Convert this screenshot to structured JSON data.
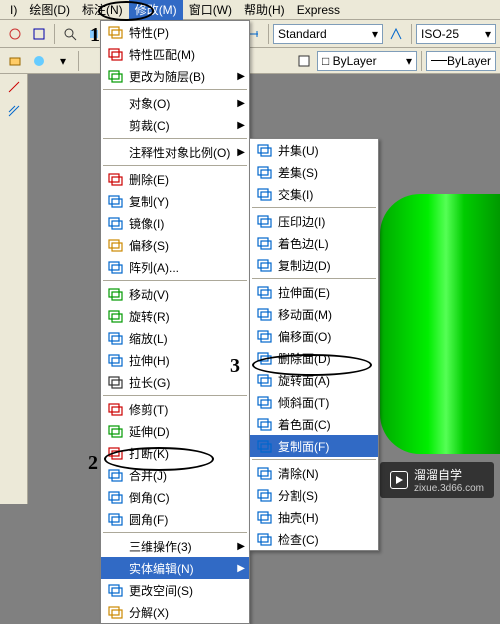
{
  "menubar": {
    "items": [
      "I)",
      "绘图(D)",
      "标注(N)",
      "修改(M)",
      "窗口(W)",
      "帮助(H)",
      "Express"
    ],
    "active": 3
  },
  "toolbar_dd": {
    "std": "Standard",
    "iso": "ISO-25",
    "layer": "ByLayer",
    "color": "□ ByLayer"
  },
  "menu1": [
    {
      "lbl": "特性(P)",
      "ico": "props"
    },
    {
      "lbl": "特性匹配(M)",
      "ico": "match"
    },
    {
      "lbl": "更改为随层(B)",
      "ico": "bylayer",
      "ar": true
    },
    {
      "sep": true
    },
    {
      "lbl": "对象(O)",
      "ar": true
    },
    {
      "lbl": "剪裁(C)",
      "ar": true
    },
    {
      "sep": true
    },
    {
      "lbl": "注释性对象比例(O)",
      "ar": true
    },
    {
      "sep": true
    },
    {
      "lbl": "删除(E)",
      "ico": "erase"
    },
    {
      "lbl": "复制(Y)",
      "ico": "copy"
    },
    {
      "lbl": "镜像(I)",
      "ico": "mirror"
    },
    {
      "lbl": "偏移(S)",
      "ico": "offset"
    },
    {
      "lbl": "阵列(A)...",
      "ico": "array"
    },
    {
      "sep": true
    },
    {
      "lbl": "移动(V)",
      "ico": "move"
    },
    {
      "lbl": "旋转(R)",
      "ico": "rotate"
    },
    {
      "lbl": "缩放(L)",
      "ico": "scale"
    },
    {
      "lbl": "拉伸(H)",
      "ico": "stretch"
    },
    {
      "lbl": "拉长(G)",
      "ico": "lengthen"
    },
    {
      "sep": true
    },
    {
      "lbl": "修剪(T)",
      "ico": "trim"
    },
    {
      "lbl": "延伸(D)",
      "ico": "extend"
    },
    {
      "lbl": "打断(K)",
      "ico": "break"
    },
    {
      "lbl": "合并(J)",
      "ico": "join"
    },
    {
      "lbl": "倒角(C)",
      "ico": "chamfer"
    },
    {
      "lbl": "圆角(F)",
      "ico": "fillet"
    },
    {
      "sep": true
    },
    {
      "lbl": "三维操作(3)",
      "ar": true
    },
    {
      "lbl": "实体编辑(N)",
      "ar": true,
      "hl": true
    },
    {
      "lbl": "更改空间(S)",
      "ico": "space"
    },
    {
      "lbl": "分解(X)",
      "ico": "explode"
    }
  ],
  "menu2": [
    {
      "lbl": "并集(U)",
      "ico": "union"
    },
    {
      "lbl": "差集(S)",
      "ico": "subtract"
    },
    {
      "lbl": "交集(I)",
      "ico": "intersect"
    },
    {
      "sep": true
    },
    {
      "lbl": "压印边(I)",
      "ico": "imprint"
    },
    {
      "lbl": "着色边(L)",
      "ico": "coloredge"
    },
    {
      "lbl": "复制边(D)",
      "ico": "copyedge"
    },
    {
      "sep": true
    },
    {
      "lbl": "拉伸面(E)",
      "ico": "extrudeface"
    },
    {
      "lbl": "移动面(M)",
      "ico": "moveface"
    },
    {
      "lbl": "偏移面(O)",
      "ico": "offsetface"
    },
    {
      "lbl": "删除面(D)",
      "ico": "deleteface"
    },
    {
      "lbl": "旋转面(A)",
      "ico": "rotateface"
    },
    {
      "lbl": "倾斜面(T)",
      "ico": "taperface"
    },
    {
      "lbl": "着色面(C)",
      "ico": "colorface"
    },
    {
      "lbl": "复制面(F)",
      "ico": "copyface",
      "hl": true
    },
    {
      "sep": true
    },
    {
      "lbl": "清除(N)",
      "ico": "clean"
    },
    {
      "lbl": "分割(S)",
      "ico": "separate"
    },
    {
      "lbl": "抽壳(H)",
      "ico": "shell"
    },
    {
      "lbl": "检查(C)",
      "ico": "check"
    }
  ],
  "anno": {
    "a1": "1",
    "a2": "2",
    "a3": "3"
  },
  "watermark": {
    "brand": "溜溜自学",
    "url": "zixue.3d66.com"
  }
}
